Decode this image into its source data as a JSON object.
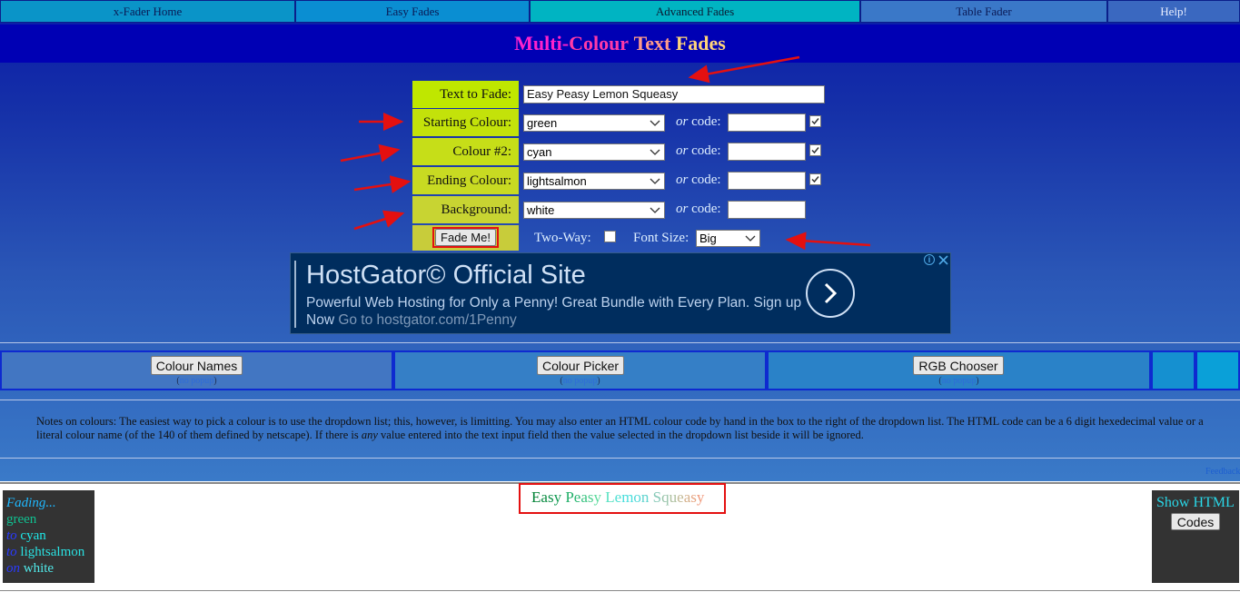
{
  "nav": {
    "tabs": [
      {
        "label": "x-Fader Home"
      },
      {
        "label": "Easy Fades"
      },
      {
        "label": "Advanced Fades"
      },
      {
        "label": "Table Fader"
      },
      {
        "label": "Help!"
      }
    ]
  },
  "page_title": {
    "word1": "Multi-",
    "word2": "Colour",
    "word3": "Text",
    "word4": "Fades"
  },
  "form": {
    "text_label": "Text to Fade:",
    "text_value": "Easy Peasy Lemon Squeasy",
    "start_label": "Starting Colour:",
    "start_value": "green",
    "colour2_label": "Colour #2:",
    "colour2_value": "cyan",
    "end_label": "Ending Colour:",
    "end_value": "lightsalmon",
    "bg_label": "Background:",
    "bg_value": "white",
    "or_word": "or",
    "code_word": " code:",
    "fade_button": "Fade Me!",
    "two_way_label": "Two-Way:",
    "font_size_label": "Font Size:",
    "font_size_value": "Big"
  },
  "ad": {
    "headline": "HostGator© Official Site",
    "body": "Powerful Web Hosting for Only a Penny! Great Bundle with Every Plan. Sign up Now",
    "link": "Go to hostgator.com/1Penny"
  },
  "tools": {
    "colour_names": "Colour Names",
    "colour_picker": "Colour Picker",
    "rgb_chooser": "RGB Chooser",
    "no_popup": "no popup"
  },
  "notes": {
    "part1": "Notes on colours: The easiest way to pick a colour is to use the dropdown list; this, however, is limitting. You may also enter an HTML colour code by hand in the box to the right of the dropdown list. The HTML code can be a 6 digit hexedecimal value or a literal colour name (of the 140 of them defined by netscape). If there is ",
    "emph": "any",
    "part2": " value entered into the text input field then the value selected in the dropdown list beside it will be ignored."
  },
  "feedback": "Feedback",
  "summary": {
    "fading": "Fading...",
    "from": "green",
    "to1_word": "to",
    "to1": "cyan",
    "to2_word": "to",
    "to2": "lightsalmon",
    "on_word": "on",
    "on": "white"
  },
  "preview": {
    "letters": [
      {
        "ch": "E",
        "c": "#038236"
      },
      {
        "ch": "a",
        "c": "#078a3f"
      },
      {
        "ch": "s",
        "c": "#0b9248"
      },
      {
        "ch": "y",
        "c": "#119b52"
      },
      {
        "ch": " ",
        "c": "#17a45c"
      },
      {
        "ch": "P",
        "c": "#1fae67"
      },
      {
        "ch": "e",
        "c": "#2bb873"
      },
      {
        "ch": "a",
        "c": "#38c380"
      },
      {
        "ch": "s",
        "c": "#4acf8e"
      },
      {
        "ch": "y",
        "c": "#5adb9c"
      },
      {
        "ch": " ",
        "c": "#66e3aa"
      },
      {
        "ch": "L",
        "c": "#58e2c2"
      },
      {
        "ch": "e",
        "c": "#4ee0d3"
      },
      {
        "ch": "m",
        "c": "#48dedd"
      },
      {
        "ch": "o",
        "c": "#4ed8d8"
      },
      {
        "ch": "n",
        "c": "#5ed3ce"
      },
      {
        "ch": " ",
        "c": "#70cdc4"
      },
      {
        "ch": "S",
        "c": "#84c8b6"
      },
      {
        "ch": "q",
        "c": "#98c4aa"
      },
      {
        "ch": "u",
        "c": "#adbf9e"
      },
      {
        "ch": "e",
        "c": "#c2b995"
      },
      {
        "ch": "a",
        "c": "#d5b08a"
      },
      {
        "ch": "s",
        "c": "#e6a683"
      },
      {
        "ch": "y",
        "c": "#f09a7c"
      }
    ]
  },
  "show_html": {
    "label": "Show HTML",
    "button": "Codes"
  },
  "colors": {
    "label_bg_lime": "#bfe700",
    "label_bg_olive": "#c8d832",
    "active_tab": "#00b4c2",
    "highlight_red": "#e41010"
  }
}
